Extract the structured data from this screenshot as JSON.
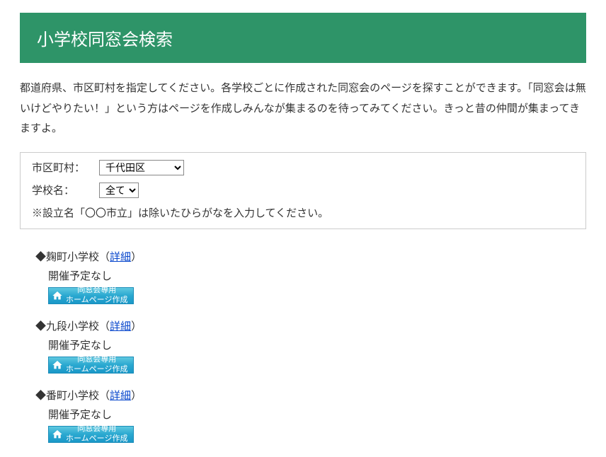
{
  "header": {
    "title": "小学校同窓会検索"
  },
  "description": "都道府県、市区町村を指定してください。各学校ごとに作成された同窓会のページを探すことができます。「同窓会は無いけどやりたい！」という方はページを作成しみんなが集まるのを待ってみてください。きっと昔の仲間が集まってきますよ。",
  "form": {
    "ward_label": "市区町村：",
    "ward_selected": "千代田区",
    "school_label": "学校名：",
    "school_selected": "全て",
    "note": "※設立名「〇〇市立」は除いたひらがなを入力してください。"
  },
  "results": {
    "detail_link_label": "詳細",
    "create_btn_line1": "同窓会専用",
    "create_btn_line2": "ホームページ作成",
    "schools": [
      {
        "name": "麹町小学校",
        "status": "開催予定なし"
      },
      {
        "name": "九段小学校",
        "status": "開催予定なし"
      },
      {
        "name": "番町小学校",
        "status": "開催予定なし"
      }
    ]
  }
}
